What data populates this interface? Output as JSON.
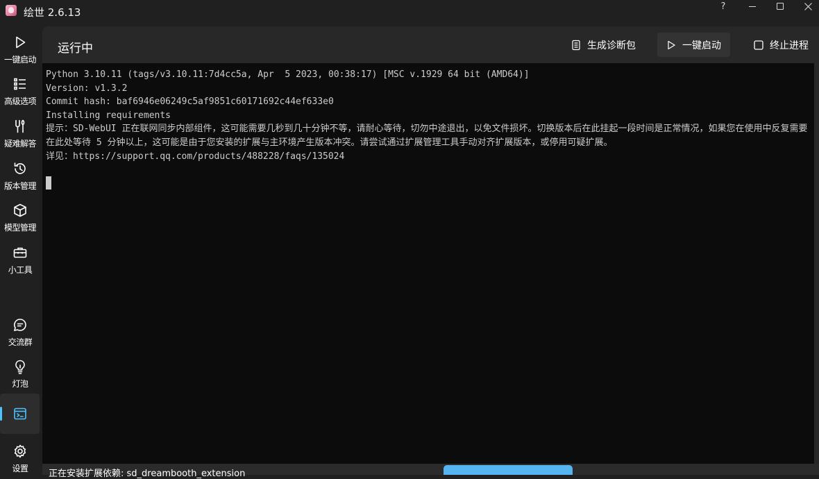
{
  "window": {
    "title": "绘世 2.6.13",
    "help_label": "?"
  },
  "sidebar": {
    "items": [
      {
        "label": "一键启动",
        "icon": "play-icon"
      },
      {
        "label": "高级选项",
        "icon": "list-icon"
      },
      {
        "label": "疑难解答",
        "icon": "wrench-icon"
      },
      {
        "label": "版本管理",
        "icon": "history-icon"
      },
      {
        "label": "模型管理",
        "icon": "cube-icon"
      },
      {
        "label": "小工具",
        "icon": "toolbox-icon"
      },
      {
        "label": "交流群",
        "icon": "chat-icon"
      },
      {
        "label": "灯泡",
        "icon": "lightbulb-icon"
      },
      {
        "label": "",
        "icon": "console-icon",
        "active": true
      },
      {
        "label": "设置",
        "icon": "gear-icon"
      }
    ],
    "accent_color": "#4cc2ff"
  },
  "header": {
    "title": "运行中",
    "diagnostics_label": "生成诊断包",
    "launch_label": "一键启动",
    "stop_label": "终止进程"
  },
  "console": {
    "lines": [
      "Python 3.10.11 (tags/v3.10.11:7d4cc5a, Apr  5 2023, 00:38:17) [MSC v.1929 64 bit (AMD64)]",
      "Version: v1.3.2",
      "Commit hash: baf6946e06249c5af9851c60171692c44ef633e0",
      "Installing requirements",
      "提示：SD-WebUI 正在联网同步内部组件，这可能需要几秒到几十分钟不等，请耐心等待，切勿中途退出，以免文件损坏。切换版本后在此挂起一段时间是正常情况，如果您在使用中反复需要在此处等待 5 分钟以上，这可能是由于您安装的扩展与主环境产生版本冲突。请尝试通过扩展管理工具手动对齐扩展版本，或停用可疑扩展。",
      "详见：https://support.qq.com/products/488228/faqs/135024"
    ]
  },
  "status": {
    "text": "正在安装扩展依赖: sd_dreambooth_extension",
    "progress_color": "#56b4f0"
  }
}
